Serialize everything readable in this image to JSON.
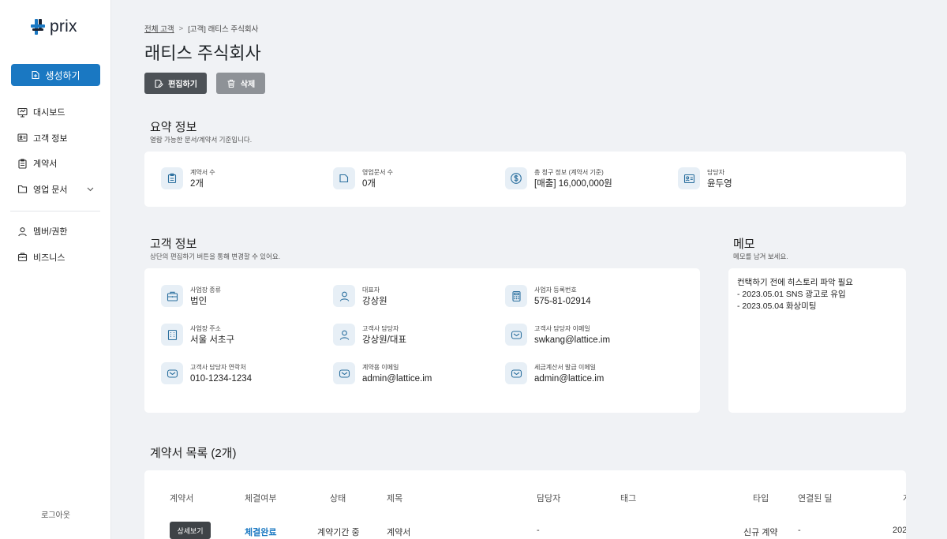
{
  "app": {
    "logo_text": "prix"
  },
  "sidebar": {
    "create_label": "생성하기",
    "items": [
      {
        "label": "대시보드",
        "icon": "dashboard-icon"
      },
      {
        "label": "고객 정보",
        "icon": "id-card-icon"
      },
      {
        "label": "계약서",
        "icon": "clipboard-icon"
      },
      {
        "label": "영업 문서",
        "icon": "folder-icon"
      }
    ],
    "items2": [
      {
        "label": "멤버/권한",
        "icon": "user-icon"
      },
      {
        "label": "비즈니스",
        "icon": "briefcase-icon"
      }
    ],
    "logout_label": "로그아웃"
  },
  "breadcrumb": {
    "root": "전체 고객",
    "separator": ">",
    "current": "[고객] 래티스 주식회사"
  },
  "page": {
    "title": "래티스 주식회사",
    "edit_label": "편집하기",
    "delete_label": "삭제"
  },
  "summary": {
    "title": "요약 정보",
    "subtitle": "열람 가능한 문서/계약서 기준입니다.",
    "fields": [
      {
        "label": "계약서 수",
        "value": "2개"
      },
      {
        "label": "영업문서 수",
        "value": "0개"
      },
      {
        "label": "총 청구 정보 (계약서 기준)",
        "value": "[매출] 16,000,000원"
      },
      {
        "label": "담당자",
        "value": "윤두영"
      }
    ]
  },
  "customer": {
    "title": "고객 정보",
    "subtitle": "상단의 편집하기 버튼을 통해 변경할 수 있어요.",
    "fields": [
      {
        "label": "사업장 종류",
        "value": "법인"
      },
      {
        "label": "대표자",
        "value": "강상원"
      },
      {
        "label": "사업자 등록번호",
        "value": "575-81-02914"
      },
      {
        "label": "사업장 주소",
        "value": "서울 서초구"
      },
      {
        "label": "고객사 담당자",
        "value": "강상원/대표"
      },
      {
        "label": "고객사 담당자 이메일",
        "value": "swkang@lattice.im"
      },
      {
        "label": "고객사 담당자 연락처",
        "value": "010-1234-1234"
      },
      {
        "label": "계약용 이메일",
        "value": "admin@lattice.im"
      },
      {
        "label": "세금계산서 발급 이메일",
        "value": "admin@lattice.im"
      }
    ]
  },
  "memo": {
    "title": "메모",
    "subtitle": "메모를 남겨 보세요.",
    "lines": [
      "컨택하기 전에 히스토리 파악 필요",
      "- 2023.05.01 SNS 광고로 유입",
      "- 2023.05.04 화상미팅"
    ]
  },
  "contracts": {
    "title": "계약서 목록 (2개)",
    "headers": [
      "계약서",
      "체결여부",
      "상태",
      "제목",
      "담당자",
      "태그",
      "타입",
      "연결된 딜",
      "계"
    ],
    "row": {
      "detail_label": "상세보기",
      "signed": "체결완료",
      "status": "계약기간 중",
      "title": "계약서",
      "owner": "-",
      "type": "신규 계약",
      "deal": "-",
      "date": "202"
    }
  },
  "colors": {
    "primary": "#1a78c2",
    "dark_button": "#4d5257",
    "gray_button": "#8e9297",
    "icon_bg": "#e7eff6"
  }
}
